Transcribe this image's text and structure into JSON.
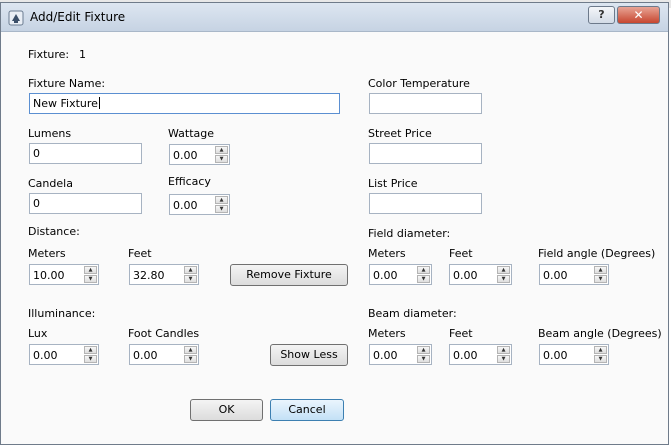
{
  "window": {
    "title": "Add/Edit Fixture",
    "help_label": "?",
    "close_label": "✕"
  },
  "fixture": {
    "label": "Fixture:",
    "number": "1"
  },
  "fixture_name": {
    "label": "Fixture Name:",
    "value": "New Fixture"
  },
  "lumens": {
    "label": "Lumens",
    "value": "0"
  },
  "wattage": {
    "label": "Wattage",
    "value": "0.00"
  },
  "candela": {
    "label": "Candela",
    "value": "0"
  },
  "efficacy": {
    "label": "Efficacy",
    "value": "0.00"
  },
  "color_temperature": {
    "label": "Color Temperature",
    "value": ""
  },
  "street_price": {
    "label": "Street Price",
    "value": ""
  },
  "list_price": {
    "label": "List Price",
    "value": ""
  },
  "distance": {
    "label": "Distance:",
    "meters": {
      "label": "Meters",
      "value": "10.00"
    },
    "feet": {
      "label": "Feet",
      "value": "32.80"
    }
  },
  "illuminance": {
    "label": "Illuminance:",
    "lux": {
      "label": "Lux",
      "value": "0.00"
    },
    "foot_candles": {
      "label": "Foot Candles",
      "value": "0.00"
    }
  },
  "field_diameter": {
    "label": "Field diameter:",
    "meters": {
      "label": "Meters",
      "value": "0.00"
    },
    "feet": {
      "label": "Feet",
      "value": "0.00"
    },
    "angle": {
      "label": "Field angle (Degrees)",
      "value": "0.00"
    }
  },
  "beam_diameter": {
    "label": "Beam diameter:",
    "meters": {
      "label": "Meters",
      "value": "0.00"
    },
    "feet": {
      "label": "Feet",
      "value": "0.00"
    },
    "angle": {
      "label": "Beam angle (Degrees)",
      "value": "0.00"
    }
  },
  "buttons": {
    "remove_fixture": "Remove Fixture",
    "show_less": "Show Less",
    "ok": "OK",
    "cancel": "Cancel"
  },
  "colors": {
    "title_bar": "#c6d3e3",
    "close_button": "#c7462f",
    "default_button": "#c3e1f6"
  }
}
